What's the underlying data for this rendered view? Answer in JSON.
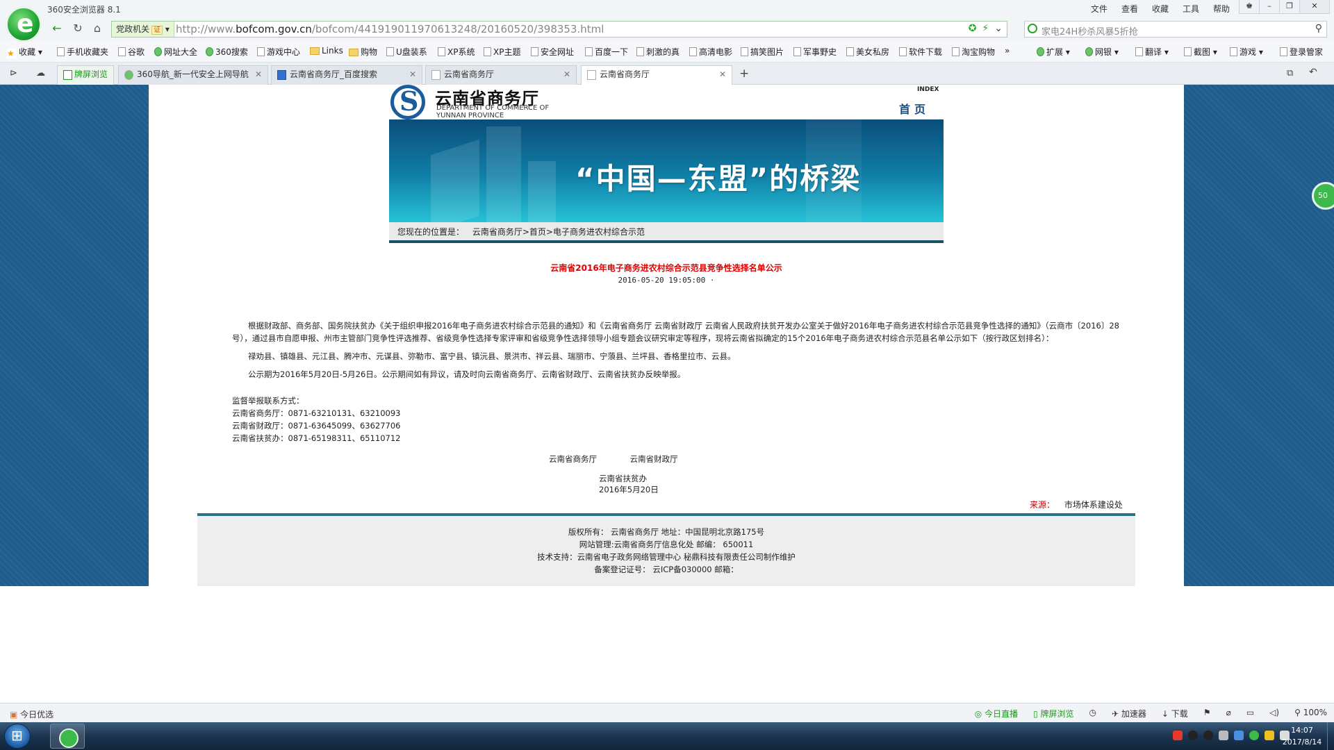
{
  "browser": {
    "app_title": "360安全浏览器 8.1",
    "menu": [
      "文件",
      "查看",
      "收藏",
      "工具",
      "帮助"
    ],
    "gov_badge": "党政机关",
    "gov_cert": "证",
    "url_prefix": "http://www.",
    "url_domain": "bofcom.gov.cn",
    "url_path": "/bofcom/441919011970613248/20160520/398353.html",
    "search_placeholder": "家电24H秒杀风暴5折抢",
    "bookmarks": [
      "收藏",
      "手机收藏夹",
      "谷歌",
      "网址大全",
      "360搜索",
      "游戏中心",
      "Links",
      "购物",
      "U盘装系",
      "XP系统",
      "XP主题",
      "安全网址",
      "百度一下",
      "刺激的真",
      "高清电影",
      "搞笑图片",
      "军事野史",
      "美女私房",
      "软件下载",
      "淘宝购物",
      "»",
      "扩展",
      "网银",
      "翻译",
      "截图",
      "游戏",
      "登录管家"
    ],
    "tabs": [
      {
        "label": "牌屏浏览"
      },
      {
        "label": "360导航_新一代安全上网导航"
      },
      {
        "label": "云南省商务厅_百度搜索"
      },
      {
        "label": "云南省商务厅"
      },
      {
        "label": "云南省商务厅"
      }
    ],
    "float_badge": "50"
  },
  "site": {
    "name_cn": "云南省商务厅",
    "name_en": "DEPARTMENT OF COMMERCE OF YUNNAN PROVINCE",
    "index_en": "INDEX",
    "home_cn": "首页",
    "banner_slogan": "“中国—东盟”的桥梁",
    "breadcrumb_label": "您现在的位置是：",
    "breadcrumb_path": "云南省商务厅>首页>电子商务进农村综合示范"
  },
  "article": {
    "title": "云南省2016年电子商务进农村综合示范县竞争性选择名单公示",
    "date": "2016-05-20 19:05:00 ·",
    "para1": "根据财政部、商务部、国务院扶贫办《关于组织申报2016年电子商务进农村综合示范县的通知》和《云南省商务厅 云南省财政厅 云南省人民政府扶贫开发办公室关于做好2016年电子商务进农村综合示范县竞争性选择的通知》（云商市〔2016〕28号），通过县市自愿申报、州市主管部门竞争性评选推荐、省级竞争性选择专家评审和省级竞争性选择领导小组专题会议研究审定等程序，现将云南省拟确定的15个2016年电子商务进农村综合示范县名单公示如下（按行政区划排名）：",
    "para2": "禄劝县、镇雄县、元江县、腾冲市、元谋县、弥勒市、富宁县、镇沅县、景洪市、祥云县、瑞丽市、宁蒗县、兰坪县、香格里拉市、云县。",
    "para3": "公示期为2016年5月20日-5月26日。公示期间如有异议，请及时向云南省商务厅、云南省财政厅、云南省扶贫办反映举报。",
    "contact_heading": "监督举报联系方式：",
    "contacts": [
      "云南省商务厅：0871-63210131、63210093",
      "云南省财政厅：0871-63645099、63627706",
      "云南省扶贫办：0871-65198311、65110712"
    ],
    "signer1": "云南省商务厅",
    "signer2": "云南省财政厅",
    "signer3": "云南省扶贫办",
    "sign_date": "2016年5月20日",
    "source_label": "来源：",
    "source_value": "市场体系建设处"
  },
  "footer": {
    "line1": "版权所有： 云南省商务厅 地址：中国昆明北京路175号",
    "line2": "网站管理:云南省商务厅信息化处    邮编： 650011",
    "line3": "技术支持：云南省电子政务网络管理中心 秘鼎科技有限责任公司制作维护",
    "line4": "备案登记证号： 云ICP备030000 邮箱："
  },
  "statusbar": {
    "left": "今日优选",
    "items": [
      "今日直播",
      "牌屏浏览",
      "加速器",
      "下载",
      "100%"
    ]
  },
  "taskbar": {
    "time": "14:07",
    "date": "2017/8/14"
  }
}
